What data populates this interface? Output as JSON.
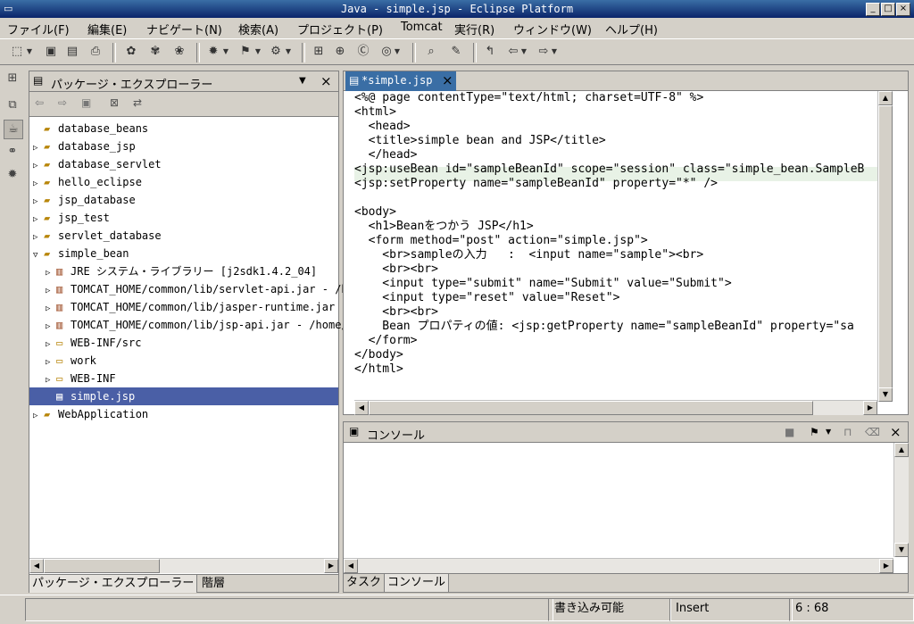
{
  "window": {
    "title": "Java - simple.jsp - Eclipse Platform",
    "btn_min": "_",
    "btn_max": "□",
    "btn_close": "×"
  },
  "menu": [
    {
      "label": "ファイル(F)"
    },
    {
      "label": "編集(E)"
    },
    {
      "label": "ナビゲート(N)"
    },
    {
      "label": "検索(A)"
    },
    {
      "label": "プロジェクト(P)"
    },
    {
      "label": "Tomcat"
    },
    {
      "label": "実行(R)"
    },
    {
      "label": "ウィンドウ(W)"
    },
    {
      "label": "ヘルプ(H)"
    }
  ],
  "package_explorer": {
    "title": "パッケージ・エクスプローラー",
    "menu_glyph": "▼",
    "close_glyph": "×",
    "items": [
      {
        "label": "database_beans",
        "expanded": null
      },
      {
        "label": "database_jsp",
        "expanded": false
      },
      {
        "label": "database_servlet",
        "expanded": false
      },
      {
        "label": "hello_eclipse",
        "expanded": false
      },
      {
        "label": "jsp_database",
        "expanded": false
      },
      {
        "label": "jsp_test",
        "expanded": false
      },
      {
        "label": "servlet_database",
        "expanded": false
      },
      {
        "label": "simple_bean",
        "expanded": true
      },
      {
        "label": "JRE システム・ライブラリー [j2sdk1.4.2_04]",
        "expanded": false
      },
      {
        "label": "TOMCAT_HOME/common/lib/servlet-api.jar - /h",
        "expanded": false
      },
      {
        "label": "TOMCAT_HOME/common/lib/jasper-runtime.jar -",
        "expanded": false
      },
      {
        "label": "TOMCAT_HOME/common/lib/jsp-api.jar - /home/",
        "expanded": false
      },
      {
        "label": "WEB-INF/src",
        "expanded": false
      },
      {
        "label": "work",
        "expanded": false
      },
      {
        "label": "WEB-INF",
        "expanded": false
      },
      {
        "label": "simple.jsp",
        "expanded": null,
        "selected": true
      },
      {
        "label": "WebApplication",
        "expanded": false
      }
    ],
    "bottom_tabs": [
      "パッケージ・エクスプローラー",
      "階層"
    ]
  },
  "editor": {
    "tab_label": "*simple.jsp",
    "tab_close": "×",
    "lines": [
      "<%@ page contentType=\"text/html; charset=UTF-8\" %>",
      "<html>",
      "  <head>",
      "  <title>simple bean and JSP</title>",
      "  </head>",
      "<jsp:useBean id=\"sampleBeanId\" scope=\"session\" class=\"simple_bean.SampleB",
      "<jsp:setProperty name=\"sampleBeanId\" property=\"*\" />",
      "",
      "<body>",
      "  <h1>Beanをつかう JSP</h1>",
      "  <form method=\"post\" action=\"simple.jsp\">",
      "    <br>sampleの入力   :  <input name=\"sample\"><br>",
      "    <br><br>",
      "    <input type=\"submit\" name=\"Submit\" value=\"Submit\">",
      "    <input type=\"reset\" value=\"Reset\">",
      "    <br><br>",
      "    Bean プロパティの値: <jsp:getProperty name=\"sampleBeanId\" property=\"sa",
      "  </form>",
      "</body>",
      "</html>"
    ],
    "highlight_line": 6
  },
  "console": {
    "title": "コンソール",
    "close_glyph": "×",
    "bottom_tabs": [
      "タスク",
      "コンソール"
    ]
  },
  "status": {
    "writable": "書き込み可能",
    "mode": "Insert",
    "position": "6 : 68"
  }
}
